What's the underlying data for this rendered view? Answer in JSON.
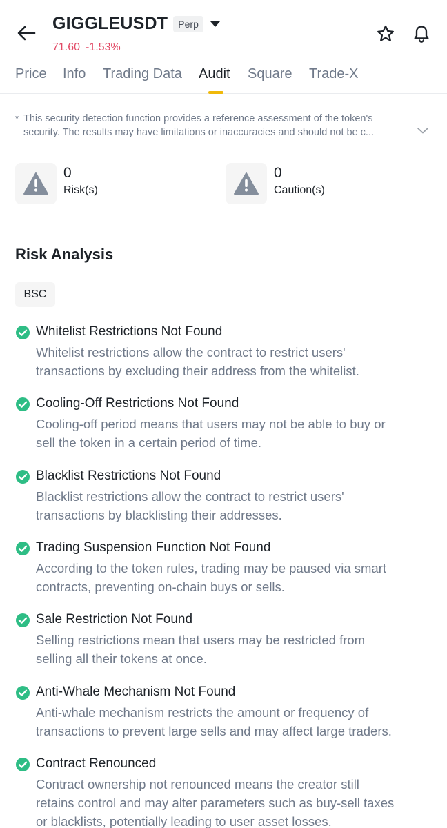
{
  "header": {
    "symbol": "GIGGLEUSDT",
    "badge": "Perp",
    "price": "71.60",
    "change": "-1.53%",
    "colors": {
      "negative": "#e24a66",
      "accent": "#f0b90b"
    },
    "icons": [
      "back-arrow-icon",
      "star-icon",
      "bell-icon",
      "chevron-down-icon"
    ]
  },
  "tabs": [
    {
      "label": "Price"
    },
    {
      "label": "Info"
    },
    {
      "label": "Trading Data"
    },
    {
      "label": "Audit",
      "active": true
    },
    {
      "label": "Square"
    },
    {
      "label": "Trade-X"
    }
  ],
  "disclaimer": {
    "marker": "*",
    "line1": "This security detection function provides a reference assessment of the token's",
    "line2": "security. The results may have limitations or inaccuracies and should not be c..."
  },
  "stats": [
    {
      "count": "0",
      "label": "Risk(s)",
      "icon": "warning-icon"
    },
    {
      "count": "0",
      "label": "Caution(s)",
      "icon": "warning-icon"
    }
  ],
  "risk_analysis": {
    "title": "Risk Analysis",
    "chain": "BSC",
    "items": [
      {
        "title": "Whitelist Restrictions Not Found",
        "lines": [
          "Whitelist restrictions allow the contract to restrict users'",
          "transactions by excluding their address from the whitelist."
        ]
      },
      {
        "title": "Cooling-Off Restrictions Not Found",
        "lines": [
          "Cooling-off period means that users may not be able to buy or",
          "sell the token in a certain period of time."
        ]
      },
      {
        "title": "Blacklist Restrictions Not Found",
        "lines": [
          "Blacklist restrictions allow the contract to restrict users'",
          "transactions by blacklisting their addresses."
        ]
      },
      {
        "title": "Trading Suspension Function Not Found",
        "lines": [
          "According to the token rules, trading may be paused via smart",
          "contracts, preventing on-chain buys or sells."
        ]
      },
      {
        "title": "Sale Restriction Not Found",
        "lines": [
          "Selling restrictions mean that users may be restricted from",
          "selling all their tokens at once."
        ]
      },
      {
        "title": "Anti-Whale Mechanism Not Found",
        "lines": [
          "Anti-whale mechanism restricts the amount or frequency of",
          "transactions to prevent large sells and may affect large traders."
        ]
      },
      {
        "title": "Contract Renounced",
        "lines": [
          "Contract ownership not renounced means the creator still",
          "retains control and may alter parameters such as buy-sell taxes",
          "or blacklists, potentially leading to user asset losses."
        ]
      }
    ],
    "check_color": "#2ebd85"
  }
}
